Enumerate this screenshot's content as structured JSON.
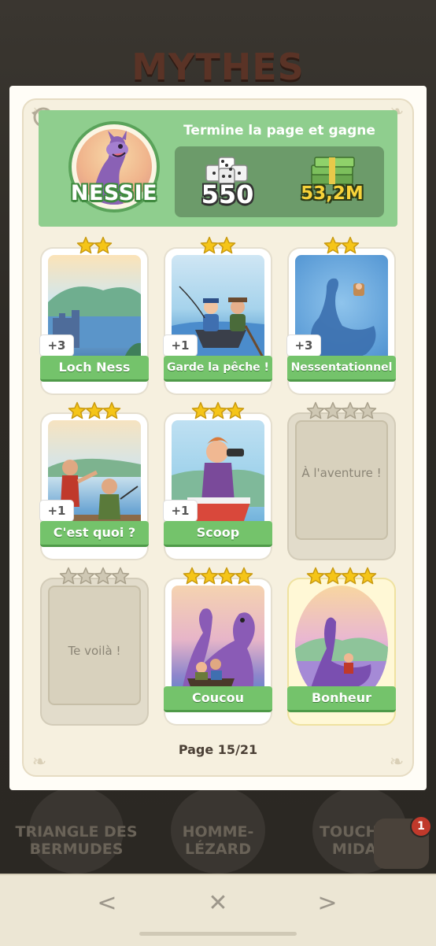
{
  "background": {
    "album_title": "MYTHES",
    "albums": [
      {
        "label": "TRIANGLE DES BERMUDES"
      },
      {
        "label": "HOMME-LÉZARD"
      },
      {
        "label": "TOUCHER MIDAS"
      }
    ],
    "notification_count": "1"
  },
  "header": {
    "set_name": "NESSIE",
    "reward_title": "Termine la page et gagne",
    "dice_reward": "550",
    "cash_reward": "53,2M"
  },
  "stickers": [
    {
      "name": "Loch Ness",
      "stars": 2,
      "count": "+3",
      "collected": true
    },
    {
      "name": "Garde la pêche !",
      "stars": 2,
      "count": "+1",
      "collected": true
    },
    {
      "name": "Nessentationnel",
      "stars": 2,
      "count": "+3",
      "collected": true
    },
    {
      "name": "C'est quoi ?",
      "stars": 3,
      "count": "+1",
      "collected": true
    },
    {
      "name": "Scoop",
      "stars": 3,
      "count": "+1",
      "collected": true
    },
    {
      "name": "À l'aventure !",
      "stars": 4,
      "count": "",
      "collected": false
    },
    {
      "name": "Te voilà !",
      "stars": 4,
      "count": "",
      "collected": false
    },
    {
      "name": "Coucou",
      "stars": 4,
      "count": "",
      "collected": true
    },
    {
      "name": "Bonheur",
      "stars": 4,
      "count": "",
      "collected": true
    }
  ],
  "page_indicator": "Page 15/21",
  "nav": {
    "prev": "<",
    "close": "✕",
    "next": ">"
  },
  "colors": {
    "header_green": "#8fce8e",
    "label_green": "#74c36b",
    "star_gold": "#f5c518",
    "star_grey": "#cfc8b4"
  },
  "icons": [
    "history-icon",
    "dice-icon",
    "cash-icon",
    "star-icon",
    "chevron-left-icon",
    "close-icon",
    "chevron-right-icon"
  ]
}
